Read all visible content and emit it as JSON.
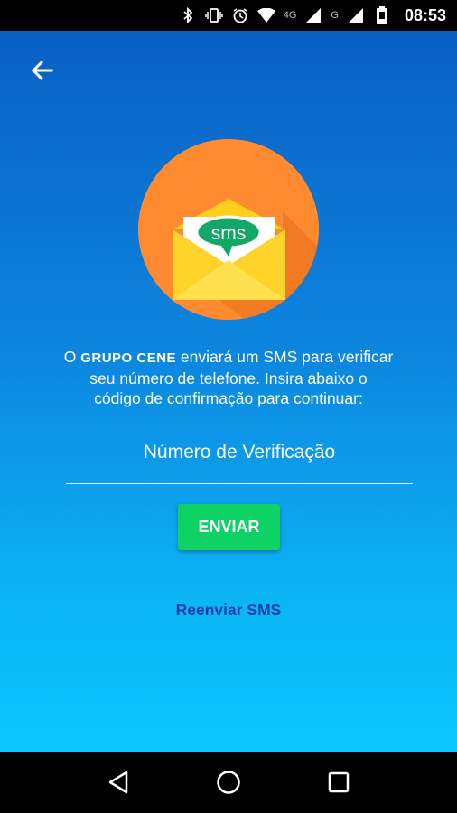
{
  "status_bar": {
    "icons": [
      "bluetooth-icon",
      "vibrate-icon",
      "alarm-icon",
      "wifi-icon",
      "signal-4g-icon",
      "signal-g-icon",
      "battery-icon"
    ],
    "net_4g": "4G",
    "net_g": "G",
    "time": "08:53"
  },
  "header": {
    "back_icon": "arrow-left-icon"
  },
  "logo": {
    "icon": "sms-envelope-icon",
    "text": "sms"
  },
  "message": {
    "prefix": "O",
    "brand": "GRUPO CENE",
    "line1_rest": "enviará um SMS para verificar",
    "line2": "seu número de telefone. Insira abaixo o",
    "line3": "código de confirmação para continuar:"
  },
  "verification": {
    "placeholder": "Número de Verificação",
    "value": ""
  },
  "send_button": {
    "label": "ENVIAR"
  },
  "resend_link": {
    "label": "Reenviar SMS"
  },
  "nav_bar": {
    "icons": [
      "back-triangle-icon",
      "home-circle-icon",
      "recents-square-icon"
    ]
  },
  "colors": {
    "gradient_top": "#0a5fc4",
    "gradient_bottom": "#0ac6ff",
    "logo_circle": "#ff8a30",
    "envelope": "#ffd42a",
    "sms_bubble": "#12a865",
    "send_button": "#0fd264",
    "resend_link": "#1a3fa6"
  }
}
